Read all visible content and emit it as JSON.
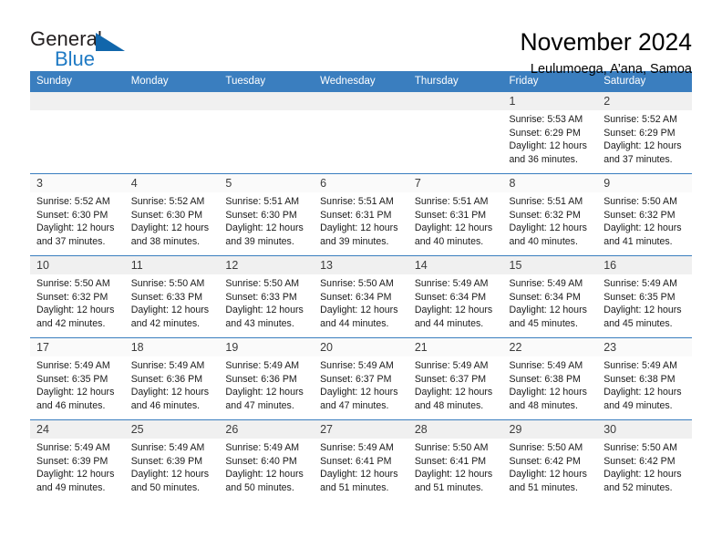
{
  "brand": {
    "word_one": "General",
    "word_two": "Blue",
    "triangle_color": "#1166ab",
    "blue_text_color": "#1f7ac4"
  },
  "header": {
    "title": "November 2024",
    "subtitle": "Leulumoega, A’ana, Samoa",
    "accent_color": "#3a7ebf"
  },
  "weekdays": [
    "Sunday",
    "Monday",
    "Tuesday",
    "Wednesday",
    "Thursday",
    "Friday",
    "Saturday"
  ],
  "labels": {
    "sunrise_prefix": "Sunrise:",
    "sunset_prefix": "Sunset:",
    "daylight_prefix": "Daylight:"
  },
  "weeks": [
    [
      {
        "day": "",
        "sunrise": "",
        "sunset": "",
        "daylight_line1": "",
        "daylight_line2": "",
        "empty": true
      },
      {
        "day": "",
        "sunrise": "",
        "sunset": "",
        "daylight_line1": "",
        "daylight_line2": "",
        "empty": true
      },
      {
        "day": "",
        "sunrise": "",
        "sunset": "",
        "daylight_line1": "",
        "daylight_line2": "",
        "empty": true
      },
      {
        "day": "",
        "sunrise": "",
        "sunset": "",
        "daylight_line1": "",
        "daylight_line2": "",
        "empty": true
      },
      {
        "day": "",
        "sunrise": "",
        "sunset": "",
        "daylight_line1": "",
        "daylight_line2": "",
        "empty": true
      },
      {
        "day": "1",
        "sunrise": "Sunrise: 5:53 AM",
        "sunset": "Sunset: 6:29 PM",
        "daylight_line1": "Daylight: 12 hours",
        "daylight_line2": "and 36 minutes."
      },
      {
        "day": "2",
        "sunrise": "Sunrise: 5:52 AM",
        "sunset": "Sunset: 6:29 PM",
        "daylight_line1": "Daylight: 12 hours",
        "daylight_line2": "and 37 minutes."
      }
    ],
    [
      {
        "day": "3",
        "sunrise": "Sunrise: 5:52 AM",
        "sunset": "Sunset: 6:30 PM",
        "daylight_line1": "Daylight: 12 hours",
        "daylight_line2": "and 37 minutes."
      },
      {
        "day": "4",
        "sunrise": "Sunrise: 5:52 AM",
        "sunset": "Sunset: 6:30 PM",
        "daylight_line1": "Daylight: 12 hours",
        "daylight_line2": "and 38 minutes."
      },
      {
        "day": "5",
        "sunrise": "Sunrise: 5:51 AM",
        "sunset": "Sunset: 6:30 PM",
        "daylight_line1": "Daylight: 12 hours",
        "daylight_line2": "and 39 minutes."
      },
      {
        "day": "6",
        "sunrise": "Sunrise: 5:51 AM",
        "sunset": "Sunset: 6:31 PM",
        "daylight_line1": "Daylight: 12 hours",
        "daylight_line2": "and 39 minutes."
      },
      {
        "day": "7",
        "sunrise": "Sunrise: 5:51 AM",
        "sunset": "Sunset: 6:31 PM",
        "daylight_line1": "Daylight: 12 hours",
        "daylight_line2": "and 40 minutes."
      },
      {
        "day": "8",
        "sunrise": "Sunrise: 5:51 AM",
        "sunset": "Sunset: 6:32 PM",
        "daylight_line1": "Daylight: 12 hours",
        "daylight_line2": "and 40 minutes."
      },
      {
        "day": "9",
        "sunrise": "Sunrise: 5:50 AM",
        "sunset": "Sunset: 6:32 PM",
        "daylight_line1": "Daylight: 12 hours",
        "daylight_line2": "and 41 minutes."
      }
    ],
    [
      {
        "day": "10",
        "sunrise": "Sunrise: 5:50 AM",
        "sunset": "Sunset: 6:32 PM",
        "daylight_line1": "Daylight: 12 hours",
        "daylight_line2": "and 42 minutes."
      },
      {
        "day": "11",
        "sunrise": "Sunrise: 5:50 AM",
        "sunset": "Sunset: 6:33 PM",
        "daylight_line1": "Daylight: 12 hours",
        "daylight_line2": "and 42 minutes."
      },
      {
        "day": "12",
        "sunrise": "Sunrise: 5:50 AM",
        "sunset": "Sunset: 6:33 PM",
        "daylight_line1": "Daylight: 12 hours",
        "daylight_line2": "and 43 minutes."
      },
      {
        "day": "13",
        "sunrise": "Sunrise: 5:50 AM",
        "sunset": "Sunset: 6:34 PM",
        "daylight_line1": "Daylight: 12 hours",
        "daylight_line2": "and 44 minutes."
      },
      {
        "day": "14",
        "sunrise": "Sunrise: 5:49 AM",
        "sunset": "Sunset: 6:34 PM",
        "daylight_line1": "Daylight: 12 hours",
        "daylight_line2": "and 44 minutes."
      },
      {
        "day": "15",
        "sunrise": "Sunrise: 5:49 AM",
        "sunset": "Sunset: 6:34 PM",
        "daylight_line1": "Daylight: 12 hours",
        "daylight_line2": "and 45 minutes."
      },
      {
        "day": "16",
        "sunrise": "Sunrise: 5:49 AM",
        "sunset": "Sunset: 6:35 PM",
        "daylight_line1": "Daylight: 12 hours",
        "daylight_line2": "and 45 minutes."
      }
    ],
    [
      {
        "day": "17",
        "sunrise": "Sunrise: 5:49 AM",
        "sunset": "Sunset: 6:35 PM",
        "daylight_line1": "Daylight: 12 hours",
        "daylight_line2": "and 46 minutes."
      },
      {
        "day": "18",
        "sunrise": "Sunrise: 5:49 AM",
        "sunset": "Sunset: 6:36 PM",
        "daylight_line1": "Daylight: 12 hours",
        "daylight_line2": "and 46 minutes."
      },
      {
        "day": "19",
        "sunrise": "Sunrise: 5:49 AM",
        "sunset": "Sunset: 6:36 PM",
        "daylight_line1": "Daylight: 12 hours",
        "daylight_line2": "and 47 minutes."
      },
      {
        "day": "20",
        "sunrise": "Sunrise: 5:49 AM",
        "sunset": "Sunset: 6:37 PM",
        "daylight_line1": "Daylight: 12 hours",
        "daylight_line2": "and 47 minutes."
      },
      {
        "day": "21",
        "sunrise": "Sunrise: 5:49 AM",
        "sunset": "Sunset: 6:37 PM",
        "daylight_line1": "Daylight: 12 hours",
        "daylight_line2": "and 48 minutes."
      },
      {
        "day": "22",
        "sunrise": "Sunrise: 5:49 AM",
        "sunset": "Sunset: 6:38 PM",
        "daylight_line1": "Daylight: 12 hours",
        "daylight_line2": "and 48 minutes."
      },
      {
        "day": "23",
        "sunrise": "Sunrise: 5:49 AM",
        "sunset": "Sunset: 6:38 PM",
        "daylight_line1": "Daylight: 12 hours",
        "daylight_line2": "and 49 minutes."
      }
    ],
    [
      {
        "day": "24",
        "sunrise": "Sunrise: 5:49 AM",
        "sunset": "Sunset: 6:39 PM",
        "daylight_line1": "Daylight: 12 hours",
        "daylight_line2": "and 49 minutes."
      },
      {
        "day": "25",
        "sunrise": "Sunrise: 5:49 AM",
        "sunset": "Sunset: 6:39 PM",
        "daylight_line1": "Daylight: 12 hours",
        "daylight_line2": "and 50 minutes."
      },
      {
        "day": "26",
        "sunrise": "Sunrise: 5:49 AM",
        "sunset": "Sunset: 6:40 PM",
        "daylight_line1": "Daylight: 12 hours",
        "daylight_line2": "and 50 minutes."
      },
      {
        "day": "27",
        "sunrise": "Sunrise: 5:49 AM",
        "sunset": "Sunset: 6:41 PM",
        "daylight_line1": "Daylight: 12 hours",
        "daylight_line2": "and 51 minutes."
      },
      {
        "day": "28",
        "sunrise": "Sunrise: 5:50 AM",
        "sunset": "Sunset: 6:41 PM",
        "daylight_line1": "Daylight: 12 hours",
        "daylight_line2": "and 51 minutes."
      },
      {
        "day": "29",
        "sunrise": "Sunrise: 5:50 AM",
        "sunset": "Sunset: 6:42 PM",
        "daylight_line1": "Daylight: 12 hours",
        "daylight_line2": "and 51 minutes."
      },
      {
        "day": "30",
        "sunrise": "Sunrise: 5:50 AM",
        "sunset": "Sunset: 6:42 PM",
        "daylight_line1": "Daylight: 12 hours",
        "daylight_line2": "and 52 minutes."
      }
    ]
  ]
}
